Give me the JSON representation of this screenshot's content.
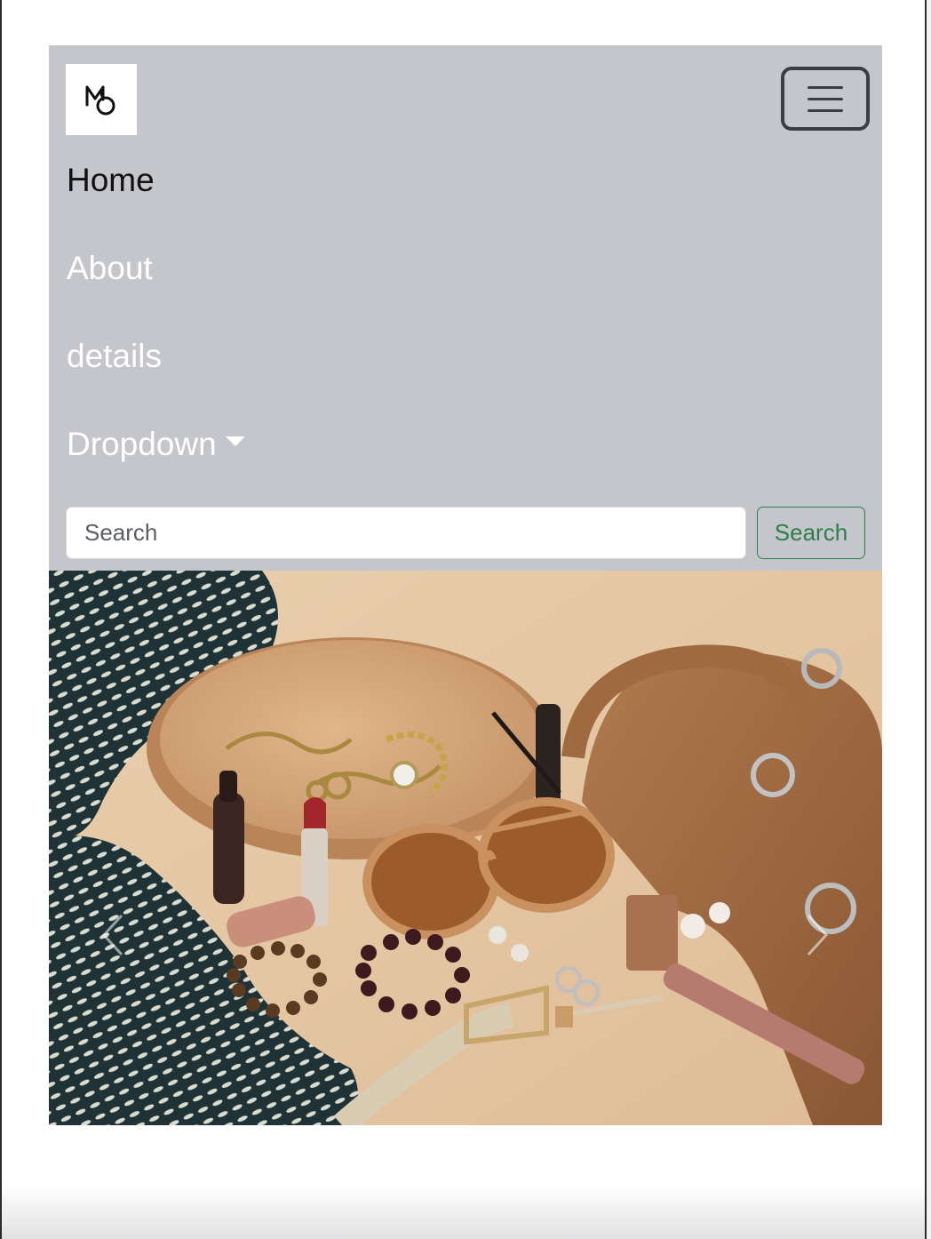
{
  "brand": {
    "logo_text": "MO",
    "logo_icon": "mo-monogram-logo"
  },
  "navbar": {
    "toggler_icon": "hamburger-menu-icon",
    "links": [
      {
        "label": "Home",
        "active": true
      },
      {
        "label": "About",
        "active": false
      },
      {
        "label": "details",
        "active": false
      },
      {
        "label": "Dropdown",
        "active": false,
        "has_caret": true
      }
    ],
    "background": "#c5c6cb"
  },
  "search": {
    "placeholder": "Search",
    "button_label": "Search",
    "button_color": "#2e7d4a"
  },
  "carousel": {
    "image_subject": "fashion accessories flat lay",
    "prev_icon": "chevron-left-icon",
    "next_icon": "chevron-right-icon"
  }
}
